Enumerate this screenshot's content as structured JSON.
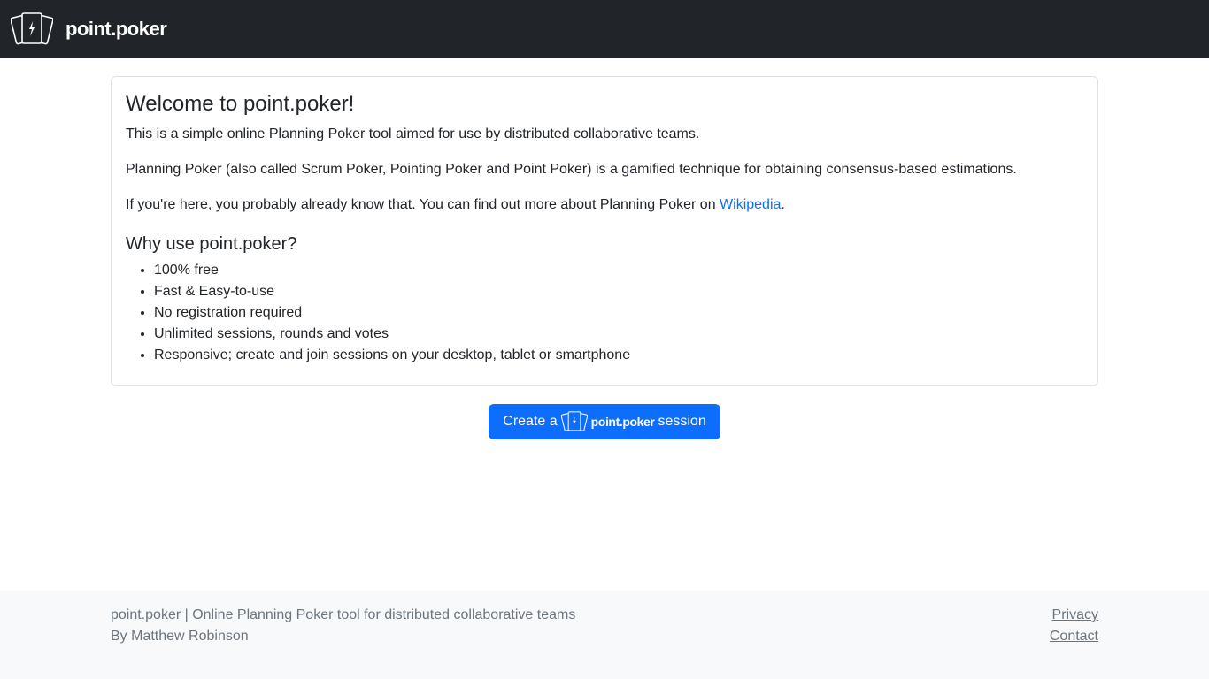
{
  "navbar": {
    "brand_text": "point.poker",
    "logo_icon": "cards-logo-icon"
  },
  "intro": {
    "title": "Welcome to point.poker!",
    "p1": "This is a simple online Planning Poker tool aimed for use by distributed collaborative teams.",
    "p2": "Planning Poker (also called Scrum Poker, Pointing Poker and Point Poker) is a gamified technique for obtaining consensus-based estimations.",
    "p3_before": "If you're here, you probably already know that. You can find out more about Planning Poker on ",
    "p3_link": "Wikipedia",
    "p3_after": ".",
    "why_title": "Why use point.poker?",
    "features": [
      "100% free",
      "Fast & Easy-to-use",
      "No registration required",
      "Unlimited sessions, rounds and votes",
      "Responsive; create and join sessions on your desktop, tablet or smartphone"
    ]
  },
  "create_button": {
    "prefix": "Create a",
    "brand": "point.poker",
    "suffix": "session"
  },
  "footer": {
    "tagline": "point.poker | Online Planning Poker tool for distributed collaborative teams",
    "author": "By Matthew Robinson",
    "privacy_link": "Privacy",
    "contact_link": "Contact"
  },
  "colors": {
    "navbar_bg": "#212529",
    "primary": "#0d6efd",
    "footer_bg": "#f8f9fa",
    "footer_text": "#6c757d"
  }
}
